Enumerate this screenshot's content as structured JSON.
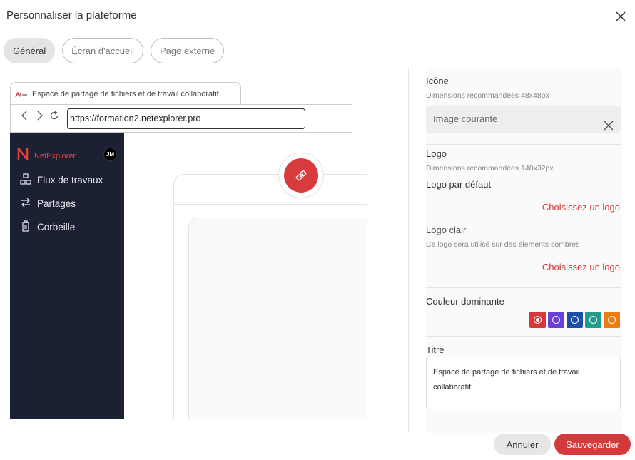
{
  "dialog": {
    "title": "Personnaliser la plateforme"
  },
  "tabs": [
    {
      "label": "Général",
      "active": true
    },
    {
      "label": "Écran d'accueil",
      "active": false
    },
    {
      "label": "Page externe",
      "active": false
    }
  ],
  "preview": {
    "browser_tab_title": "Espace de partage de fichiers et de travail collaboratif",
    "url": "https://formation2.netexplorer.pro",
    "app_name": "NetExplorer",
    "avatar_initials": "JM",
    "nav_items": [
      {
        "label": "Flux de travaux",
        "icon": "workflow-icon"
      },
      {
        "label": "Partages",
        "icon": "share-arrows-icon"
      },
      {
        "label": "Corbeille",
        "icon": "trash-icon"
      }
    ]
  },
  "settings": {
    "icon_section": {
      "label": "Icône",
      "hint": "Dimensions recommandées 48x48px",
      "current_value": "Image courante"
    },
    "logo_section": {
      "label": "Logo",
      "hint": "Dimensions recommandées 140x32px",
      "default_label": "Logo par défaut",
      "default_link": "Choisissez un logo",
      "light_label": "Logo clair",
      "light_hint": "Ce logo sera utilisé sur des éléments sombres",
      "light_link": "Choisissez un logo"
    },
    "color_section": {
      "label": "Couleur dominante",
      "swatches": [
        {
          "color": "#d6393b",
          "selected": true
        },
        {
          "color": "#6c3fd6",
          "selected": false
        },
        {
          "color": "#1e4fa8",
          "selected": false
        },
        {
          "color": "#1f9c8a",
          "selected": false
        },
        {
          "color": "#ee7a12",
          "selected": false
        }
      ]
    },
    "title_section": {
      "label": "Titre",
      "value": "Espace de partage de fichiers et de travail collaboratif"
    }
  },
  "footer": {
    "cancel_label": "Annuler",
    "save_label": "Sauvegarder"
  },
  "colors": {
    "accent": "#d6393b",
    "sidebar_bg": "#1b2033"
  }
}
